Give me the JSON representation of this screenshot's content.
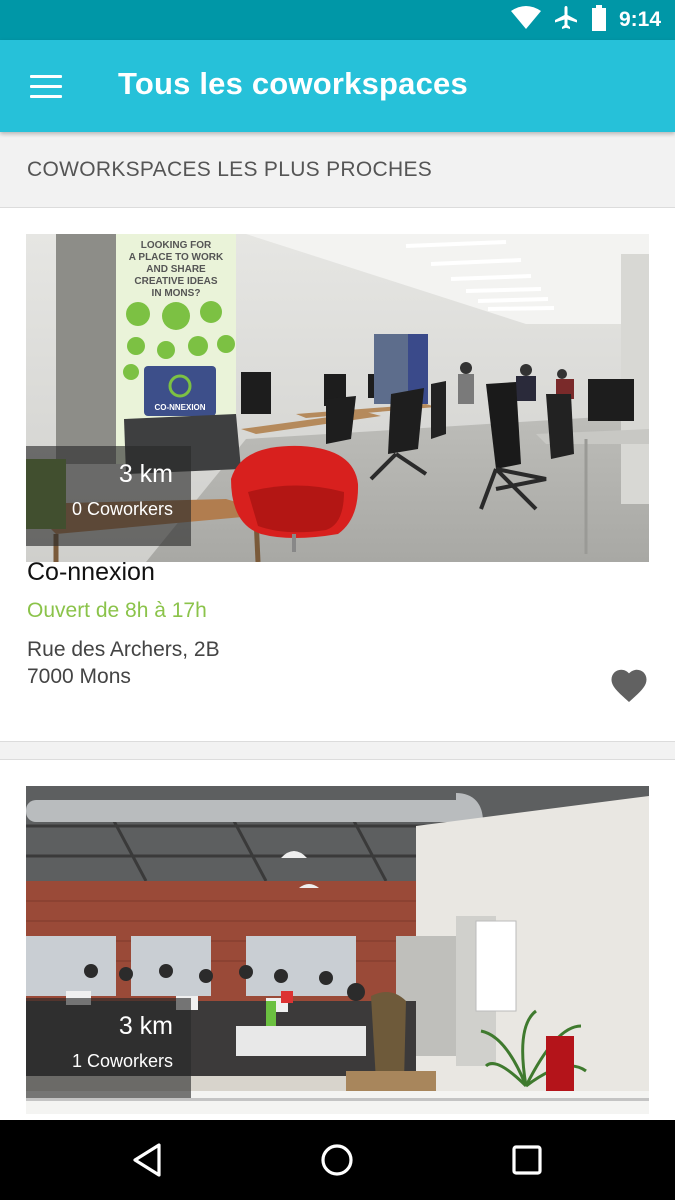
{
  "status_bar": {
    "time": "9:14"
  },
  "app_bar": {
    "title": "Tous les coworkspaces",
    "menu_icon": "hamburger-menu-icon"
  },
  "section": {
    "header": "COWORKSPACES LES PLUS PROCHES"
  },
  "cards": [
    {
      "distance": "3 km",
      "coworkers": "0 Coworkers",
      "name": "Co-nnexion",
      "hours": "Ouvert de 8h à 17h",
      "address_line1": "Rue des Archers, 2B",
      "address_line2": "7000 Mons",
      "favorite_icon": "heart-icon",
      "poster_text": "LOOKING FOR A PLACE TO WORK AND SHARE CREATIVE IDEAS IN MONS?",
      "poster_logo": "CO-NNEXION"
    },
    {
      "distance": "3 km",
      "coworkers": "1 Coworkers"
    }
  ],
  "colors": {
    "status_bar": "#0097a7",
    "app_bar": "#26c1d9",
    "hours_green": "#8bc34a",
    "heart_grey": "#616161"
  },
  "nav_bar": {
    "icons": [
      "back-icon",
      "home-icon",
      "recents-icon"
    ]
  }
}
